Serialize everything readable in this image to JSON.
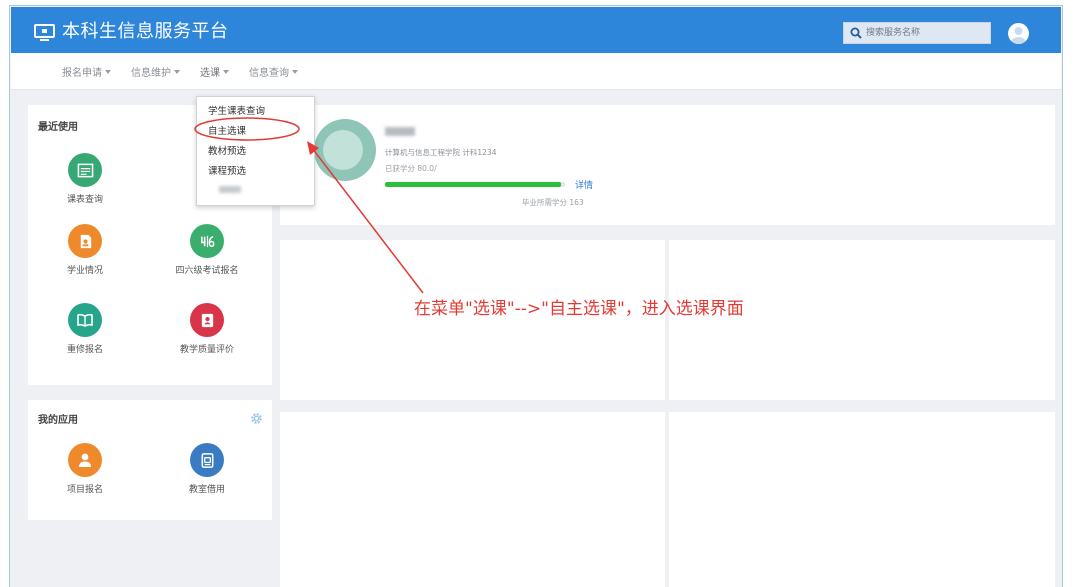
{
  "colors": {
    "header_bg": "#2d86d9",
    "accent": "#2b7fd6",
    "annotation": "#e23b36",
    "progress": "#2bbf3a",
    "profile_circle": "#8ec5b6"
  },
  "header": {
    "logo_icon": "monitor-icon",
    "title": "本科生信息服务平台",
    "search_icon": "search-icon",
    "search_placeholder": "搜索服务名称",
    "avatar_icon": "avatar-icon"
  },
  "nav": {
    "items": [
      {
        "label": "报名申请"
      },
      {
        "label": "信息维护"
      },
      {
        "label": "选课",
        "active": true
      },
      {
        "label": "信息查询"
      }
    ]
  },
  "dropdown": {
    "items": [
      {
        "label": "学生课表查询"
      },
      {
        "label": "自主选课",
        "highlighted": true
      },
      {
        "label": "教材预选"
      },
      {
        "label": "课程预选"
      }
    ]
  },
  "recent": {
    "title": "最近使用",
    "apps": [
      {
        "label": "课表查询",
        "icon": "calendar-icon",
        "color": "#36a874"
      },
      {
        "label": "学业情况",
        "icon": "report-icon",
        "color": "#ef8a2c"
      },
      {
        "label": "四六级考试报名",
        "icon": "exam-icon",
        "color": "#3bae6e"
      },
      {
        "label": "重修报名",
        "icon": "book-icon",
        "color": "#27a58a"
      },
      {
        "label": "教学质量评价",
        "icon": "evaluation-icon",
        "color": "#d8344a"
      }
    ]
  },
  "my_apps": {
    "title": "我的应用",
    "settings_icon": "gear-icon",
    "apps": [
      {
        "label": "项目报名",
        "icon": "person-icon",
        "color": "#ef8a2c"
      },
      {
        "label": "教室借用",
        "icon": "clipboard-icon",
        "color": "#3a7cc4"
      }
    ]
  },
  "profile": {
    "college_class": "计算机与信息工程学院 计科1234",
    "credits_earned": "已获学分 80.0/",
    "progress": 0.98,
    "detail_link": "详情",
    "credits_required": "毕业所需学分 163"
  },
  "annotation": {
    "text": "在菜单\"选课\"-->\"自主选课\"，进入选课界面"
  }
}
